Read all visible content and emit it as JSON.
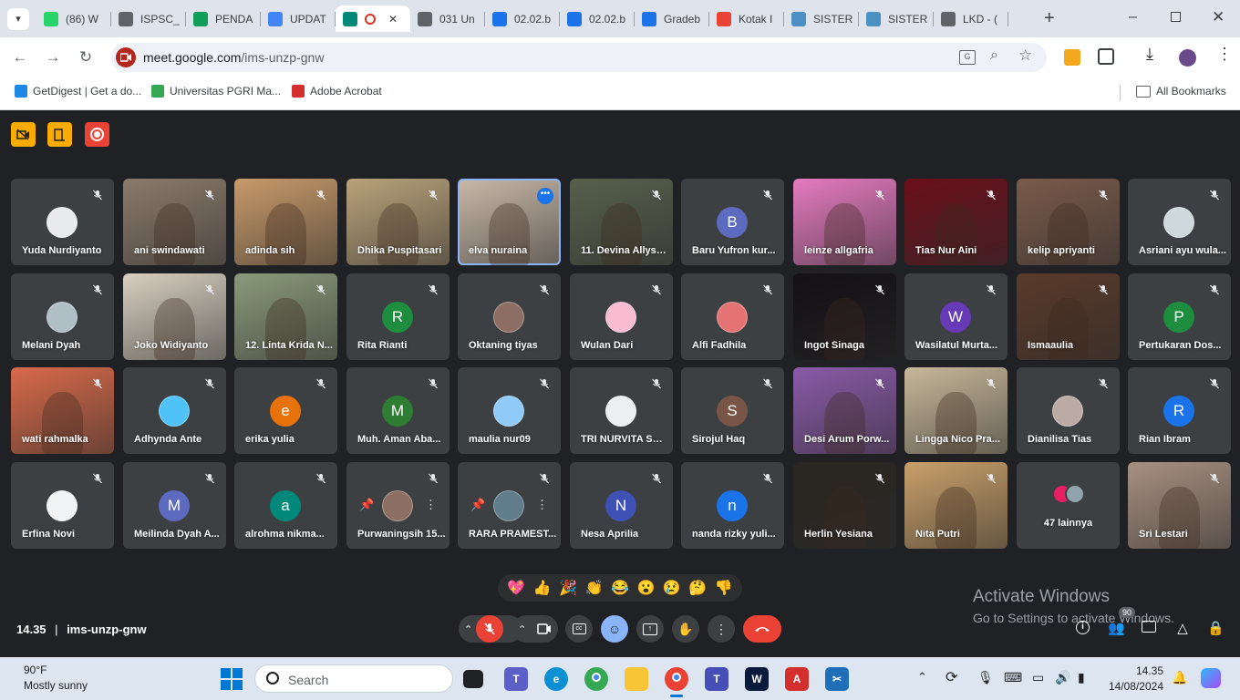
{
  "browser": {
    "tabs": [
      {
        "title": "(86) W",
        "icon": "whatsapp-icon",
        "color": "#25d366"
      },
      {
        "title": "ISPSC_",
        "icon": "globe-icon",
        "color": "#5f6368"
      },
      {
        "title": "PENDA",
        "icon": "sheets-icon",
        "color": "#0f9d58"
      },
      {
        "title": "UPDAT",
        "icon": "docs-icon",
        "color": "#4285f4"
      },
      {
        "title": "",
        "icon": "meet-icon",
        "color": "#00897b",
        "active": true
      },
      {
        "title": "031 Un",
        "icon": "globe-icon",
        "color": "#5f6368"
      },
      {
        "title": "02.02.b",
        "icon": "feather-icon",
        "color": "#1a73e8"
      },
      {
        "title": "02.02.b",
        "icon": "feather-icon",
        "color": "#1a73e8"
      },
      {
        "title": "Gradeb",
        "icon": "feather-icon",
        "color": "#1a73e8"
      },
      {
        "title": "Kotak I",
        "icon": "gmail-icon",
        "color": "#ea4335"
      },
      {
        "title": "SISTER",
        "icon": "sister-icon",
        "color": "#4a90c2"
      },
      {
        "title": "SISTER",
        "icon": "sister-icon",
        "color": "#4a90c2"
      },
      {
        "title": "LKD - (",
        "icon": "globe-icon",
        "color": "#5f6368"
      }
    ],
    "url_host": "meet.google.com",
    "url_path": "/ims-unzp-gnw",
    "bookmarks": [
      {
        "label": "GetDigest | Get a do...",
        "color": "#1e88e5"
      },
      {
        "label": "Universitas PGRI Ma...",
        "color": "#34a853"
      },
      {
        "label": "Adobe Acrobat",
        "color": "#d32f2f"
      }
    ],
    "all_bookmarks": "All Bookmarks"
  },
  "meet": {
    "participants": [
      {
        "name": "Yuda Nurdiyanto",
        "avatar": "photo",
        "color": "#e8eaed"
      },
      {
        "name": "ani swindawati",
        "video": "#8a7a6a"
      },
      {
        "name": "adinda sih",
        "video": "#c89a6a"
      },
      {
        "name": "Dhika Puspitasari",
        "video": "#b9a27a"
      },
      {
        "name": "elva nuraina",
        "video": "#c9b9a8",
        "speaking": true
      },
      {
        "name": "11. Devina Allysa...",
        "video": "#56604c"
      },
      {
        "name": "Baru Yufron kur...",
        "avatar": "B",
        "color": "#5c6bc0"
      },
      {
        "name": "leinze allgafria",
        "video": "#e57ac0"
      },
      {
        "name": "Tias Nur Aini",
        "video": "#6a0f1a"
      },
      {
        "name": "kelip apriyanti",
        "video": "#7a5a4a"
      },
      {
        "name": "Asriani ayu wula...",
        "avatar": "photo",
        "color": "#cfd8dc"
      },
      {
        "name": "Melani Dyah",
        "avatar": "photo",
        "color": "#b0bec5"
      },
      {
        "name": "Joko Widiyanto",
        "video": "#d8cfc0"
      },
      {
        "name": "12. Linta Krida N...",
        "video": "#8a9a7a"
      },
      {
        "name": "Rita Rianti",
        "avatar": "R",
        "color": "#1e8e3e"
      },
      {
        "name": "Oktaning tiyas",
        "avatar": "photo",
        "color": "#8d6e63"
      },
      {
        "name": "Wulan Dari",
        "avatar": "photo",
        "color": "#f8bbd0"
      },
      {
        "name": "Alfi Fadhila",
        "avatar": "photo",
        "color": "#e57373"
      },
      {
        "name": "Ingot Sinaga",
        "video": "#141016"
      },
      {
        "name": "Wasilatul Murta...",
        "avatar": "W",
        "color": "#673ab7"
      },
      {
        "name": "Ismaaulia",
        "video": "#5a3a2a"
      },
      {
        "name": "Pertukaran Dos...",
        "avatar": "P",
        "color": "#1e8e3e"
      },
      {
        "name": "wati rahmalka",
        "video": "#d86a4a"
      },
      {
        "name": "Adhynda Ante",
        "avatar": "photo",
        "color": "#4fc3f7"
      },
      {
        "name": "erika yulia",
        "avatar": "e",
        "color": "#e8710a"
      },
      {
        "name": "Muh. Aman Aba...",
        "avatar": "M",
        "color": "#2e7d32"
      },
      {
        "name": "maulia nur09",
        "avatar": "photo",
        "color": "#90caf9"
      },
      {
        "name": "TRI NURVITA SARI",
        "avatar": "photo",
        "color": "#eceff1"
      },
      {
        "name": "Sirojul Haq",
        "avatar": "S",
        "color": "#795548"
      },
      {
        "name": "Desi Arum Porw...",
        "video": "#8a5aa8"
      },
      {
        "name": "Lingga Nico Pra...",
        "video": "#c8b89a"
      },
      {
        "name": "Dianilisa Tias",
        "avatar": "photo",
        "color": "#bcaaa4"
      },
      {
        "name": "Rian Ibram",
        "avatar": "R",
        "color": "#1a73e8"
      },
      {
        "name": "Erfina Novi",
        "avatar": "photo",
        "color": "#f1f3f4"
      },
      {
        "name": "Meilinda Dyah A...",
        "avatar": "M",
        "color": "#5c6bc0"
      },
      {
        "name": "alrohma nikma...",
        "avatar": "a",
        "color": "#00897b"
      },
      {
        "name": "Purwaningsih 15...",
        "avatar": "photo",
        "color": "#8d6e63",
        "hover": true
      },
      {
        "name": "RARA PRAMEST...",
        "avatar": "photo",
        "color": "#607d8b",
        "hover": true
      },
      {
        "name": "Nesa Aprilia",
        "avatar": "N",
        "color": "#3f51b5"
      },
      {
        "name": "nanda rizky yuli...",
        "avatar": "n",
        "color": "#1a73e8"
      },
      {
        "name": "Herlin Yesiana",
        "video": "#2a2620"
      },
      {
        "name": "Nita Putri",
        "video": "#c9a06a"
      },
      {
        "name": "47 lainnya",
        "avatar": "stack",
        "color": "#e91e63"
      },
      {
        "name": "Sri Lestari",
        "video": "#a89080"
      }
    ],
    "reactions": [
      "💖",
      "👍",
      "🎉",
      "👏",
      "😂",
      "😮",
      "😢",
      "🤔",
      "👎"
    ],
    "time": "14.35",
    "meeting_code": "ims-unzp-gnw",
    "people_count": "90",
    "activate_title": "Activate Windows",
    "activate_sub": "Go to Settings to activate Windows."
  },
  "taskbar": {
    "weather_temp": "90°F",
    "weather_desc": "Mostly sunny",
    "search_placeholder": "Search",
    "clock_time": "14.35",
    "clock_date": "14/08/2024"
  }
}
